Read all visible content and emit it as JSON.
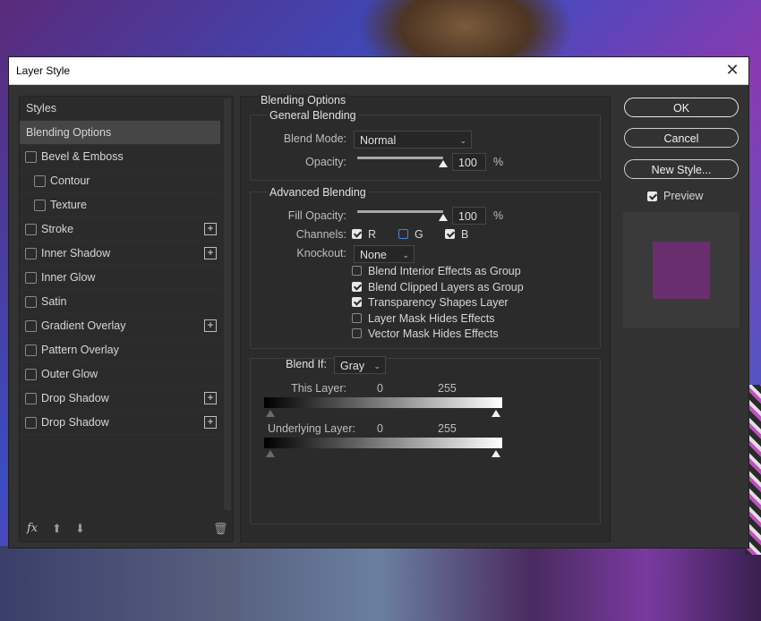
{
  "window": {
    "title": "Layer Style",
    "close_glyph": "✕"
  },
  "styles_panel": {
    "header": "Styles",
    "active_item": "Blending Options",
    "items": [
      {
        "label": "Bevel & Emboss",
        "checked": false,
        "has_plus": false,
        "indent": 0
      },
      {
        "label": "Contour",
        "checked": false,
        "has_plus": false,
        "indent": 1
      },
      {
        "label": "Texture",
        "checked": false,
        "has_plus": false,
        "indent": 1
      },
      {
        "label": "Stroke",
        "checked": false,
        "has_plus": true,
        "indent": 0
      },
      {
        "label": "Inner Shadow",
        "checked": false,
        "has_plus": true,
        "indent": 0
      },
      {
        "label": "Inner Glow",
        "checked": false,
        "has_plus": false,
        "indent": 0
      },
      {
        "label": "Satin",
        "checked": false,
        "has_plus": false,
        "indent": 0
      },
      {
        "label": "Gradient Overlay",
        "checked": false,
        "has_plus": true,
        "indent": 0
      },
      {
        "label": "Pattern Overlay",
        "checked": false,
        "has_plus": false,
        "indent": 0
      },
      {
        "label": "Outer Glow",
        "checked": false,
        "has_plus": false,
        "indent": 0
      },
      {
        "label": "Drop Shadow",
        "checked": false,
        "has_plus": true,
        "indent": 0
      },
      {
        "label": "Drop Shadow",
        "checked": false,
        "has_plus": true,
        "indent": 0
      }
    ],
    "footer": {
      "fx": "fx",
      "up": "⬆",
      "down": "⬇",
      "trash": "🗑"
    }
  },
  "blending": {
    "section_title": "Blending Options",
    "general": {
      "title": "General Blending",
      "blend_mode_label": "Blend Mode:",
      "blend_mode_value": "Normal",
      "opacity_label": "Opacity:",
      "opacity_value": "100",
      "opacity_unit": "%",
      "opacity_fraction": 1.0
    },
    "advanced": {
      "title": "Advanced Blending",
      "fill_opacity_label": "Fill Opacity:",
      "fill_opacity_value": "100",
      "fill_opacity_unit": "%",
      "fill_opacity_fraction": 1.0,
      "channels_label": "Channels:",
      "channels": [
        {
          "label": "R",
          "checked": true
        },
        {
          "label": "G",
          "checked": false
        },
        {
          "label": "B",
          "checked": true
        }
      ],
      "knockout_label": "Knockout:",
      "knockout_value": "None",
      "options": [
        {
          "label": "Blend Interior Effects as Group",
          "checked": false
        },
        {
          "label": "Blend Clipped Layers as Group",
          "checked": true
        },
        {
          "label": "Transparency Shapes Layer",
          "checked": true
        },
        {
          "label": "Layer Mask Hides Effects",
          "checked": false
        },
        {
          "label": "Vector Mask Hides Effects",
          "checked": false
        }
      ]
    },
    "blend_if": {
      "label": "Blend If:",
      "value": "Gray",
      "this_layer_label": "This Layer:",
      "this_layer_low": "0",
      "this_layer_high": "255",
      "underlying_label": "Underlying Layer:",
      "underlying_low": "0",
      "underlying_high": "255"
    }
  },
  "actions": {
    "ok": "OK",
    "cancel": "Cancel",
    "new_style": "New Style...",
    "preview_label": "Preview",
    "preview_checked": true
  },
  "colors": {
    "preview_swatch": "#6a2e6e",
    "dialog_bg": "#323232",
    "active_row": "#464646"
  },
  "chevron": "⌄"
}
